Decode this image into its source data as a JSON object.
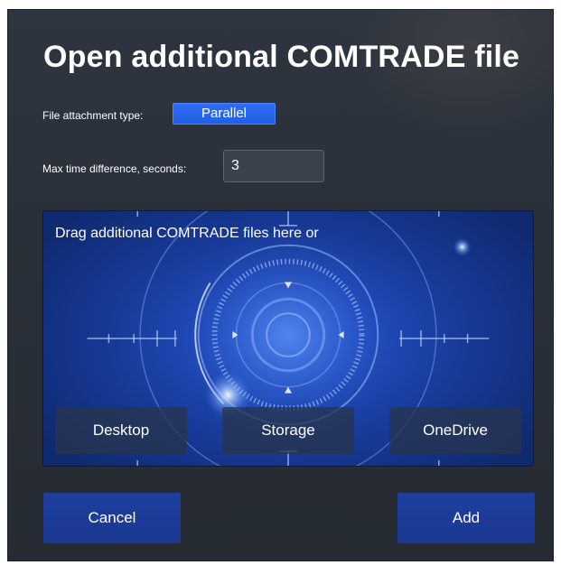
{
  "dialog": {
    "title": "Open additional COMTRADE file"
  },
  "attachment": {
    "label": "File attachment type:",
    "value": "Parallel"
  },
  "max_time": {
    "label": "Max time difference, seconds:",
    "value": "3"
  },
  "drop_zone": {
    "text": "Drag additional COMTRADE files here or",
    "sources": {
      "desktop": "Desktop",
      "storage": "Storage",
      "onedrive": "OneDrive"
    }
  },
  "actions": {
    "cancel": "Cancel",
    "add": "Add"
  },
  "colors": {
    "dialog_bg": "#2c323c",
    "accent_blue": "#2f6ef5",
    "button_blue": "#1e3f9f"
  }
}
